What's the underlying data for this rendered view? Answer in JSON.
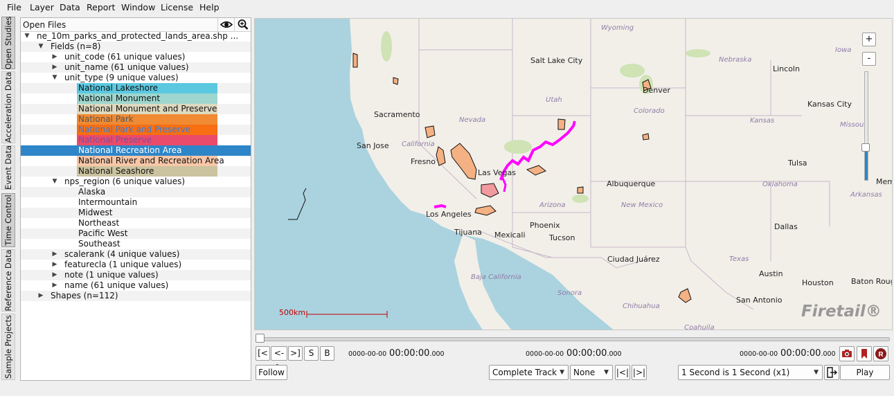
{
  "menu": [
    "File",
    "Layer",
    "Data",
    "Report",
    "Window",
    "License",
    "Help"
  ],
  "vertical_tabs": [
    "Open Studies",
    "Acceleration Data",
    "Event Data",
    "Time Control",
    "Reference Data",
    "Sample Projects"
  ],
  "files_panel": {
    "title": "Open Files",
    "eye_icon": "eye-icon",
    "zoom_icon": "zoom-in-icon",
    "file_name": "ne_10m_parks_and_protected_lands_area.shp ...",
    "fields_label": "Fields (n=8)",
    "fields": [
      "unit_code (61 unique values)",
      "unit_name (61 unique values)",
      "unit_type (9 unique values)",
      "nps_region (6 unique values)",
      "scalerank (4 unique values)",
      "featurecla (1 unique values)",
      "note (1 unique values)",
      "name (61 unique values)"
    ],
    "unit_types": [
      {
        "label": "National Lakeshore",
        "color": "#5bc8e0"
      },
      {
        "label": "National Monument",
        "color": "#9fd6cf"
      },
      {
        "label": "National Monument and Preserve",
        "color": "#ded9bf"
      },
      {
        "label": "National Park",
        "color": "#f08a33"
      },
      {
        "label": "National Park and Preserve",
        "color": "#f86e12"
      },
      {
        "label": "National Preserve",
        "color": "#eb4b6a"
      },
      {
        "label": "National Recreation Area",
        "color": "#2e86c8"
      },
      {
        "label": "National River and Recreation Area",
        "color": "#f8c7a8"
      },
      {
        "label": "National Seashore",
        "color": "#cbc3a0"
      }
    ],
    "regions": [
      "Alaska",
      "Intermountain",
      "Midwest",
      "Northeast",
      "Pacific West",
      "Southeast"
    ],
    "shapes_label": "Shapes (n=112)"
  },
  "map": {
    "cities": [
      "Salt Lake City",
      "Sacramento",
      "San Jose",
      "Fresno",
      "Las Vegas",
      "Los Angeles",
      "Tijuana",
      "Mexicali",
      "Phoenix",
      "Tucson",
      "Denver",
      "Lincoln",
      "Kansas City",
      "Tulsa",
      "Albuquerque",
      "Dallas",
      "Ciudad Juárez",
      "Austin",
      "Houston",
      "Baton Rouge",
      "San Antonio",
      "Mem"
    ],
    "states": [
      "Wyoming",
      "Iowa",
      "Nebraska",
      "Utah",
      "Colorado",
      "Nevada",
      "California",
      "Kansas",
      "Missouri",
      "Oklahoma",
      "Arkansas",
      "Arizona",
      "New Mexico",
      "Texas",
      "Baja California",
      "Sonora",
      "Chihuahua",
      "Coahuila"
    ],
    "scale": "500km",
    "zoom_in": "+",
    "zoom_out": "-",
    "brand": "Firetail®"
  },
  "time_control": {
    "nav_buttons": [
      "[<",
      "<->",
      ">]",
      "S",
      "B"
    ],
    "time_small": "0000-00-00",
    "time_big": "00:00:00",
    "time_ms": ".000",
    "follow": "Follow",
    "track_mode": "Complete Track",
    "secondary_mode": "None",
    "step_back": "|<|",
    "step_forward": "|>|",
    "speed": "1 Second is 1 Second (x1)",
    "play": "Play",
    "camera_icon": "camera-icon",
    "bookmark_icon": "bookmark-icon",
    "record_icon": "record-icon",
    "export_icon": "export-icon"
  },
  "colors": {
    "selection": "#2e86c8",
    "highlight_track": "#ff00ff",
    "park_fill": "#f4b183"
  }
}
